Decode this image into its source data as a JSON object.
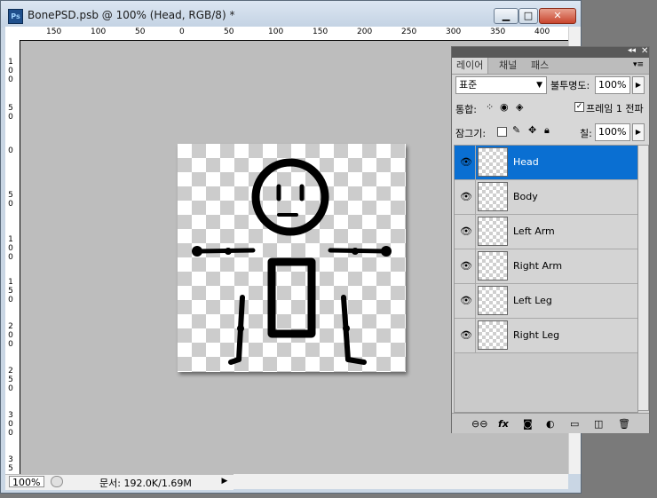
{
  "window": {
    "title": "BonePSD.psb @ 100% (Head, RGB/8) *",
    "app_icon": "Ps",
    "buttons": {
      "minimize": "▭",
      "maximize": "□",
      "close": "✕"
    }
  },
  "rulers": {
    "horizontal_labels": [
      "150",
      "100",
      "50",
      "0",
      "50",
      "100",
      "150",
      "200",
      "250",
      "300",
      "350",
      "400"
    ],
    "vertical_labels": [
      "1\n0\n0",
      "5\n0",
      "0",
      "5\n0",
      "1\n0\n0",
      "1\n5\n0",
      "2\n0\n0",
      "2\n5\n0",
      "3\n0\n0",
      "3\n5"
    ]
  },
  "statusbar": {
    "zoom": "100%",
    "doc_info": "문서: 192.0K/1.69M"
  },
  "layers_panel": {
    "tabs": [
      "레이어",
      "채널",
      "패스"
    ],
    "blend_mode": "표준",
    "opacity_label": "불투명도:",
    "opacity_value": "100%",
    "unify_label": "통합:",
    "propagate_label": "프레임 1 전파",
    "lock_label": "잠그기:",
    "fill_label": "칠:",
    "fill_value": "100%",
    "layers": [
      {
        "name": "Head",
        "selected": true
      },
      {
        "name": "Body",
        "selected": false
      },
      {
        "name": "Left Arm",
        "selected": false
      },
      {
        "name": "Right Arm",
        "selected": false
      },
      {
        "name": "Left Leg",
        "selected": false
      },
      {
        "name": "Right Leg",
        "selected": false
      }
    ],
    "bottom_icons": [
      "link-icon",
      "fx-icon",
      "mask-icon",
      "adjustment-icon",
      "folder-icon",
      "new-layer-icon",
      "trash-icon"
    ]
  },
  "colors": {
    "selection": "#0a6fd2",
    "canvas_bg": "#bdbdbd"
  }
}
